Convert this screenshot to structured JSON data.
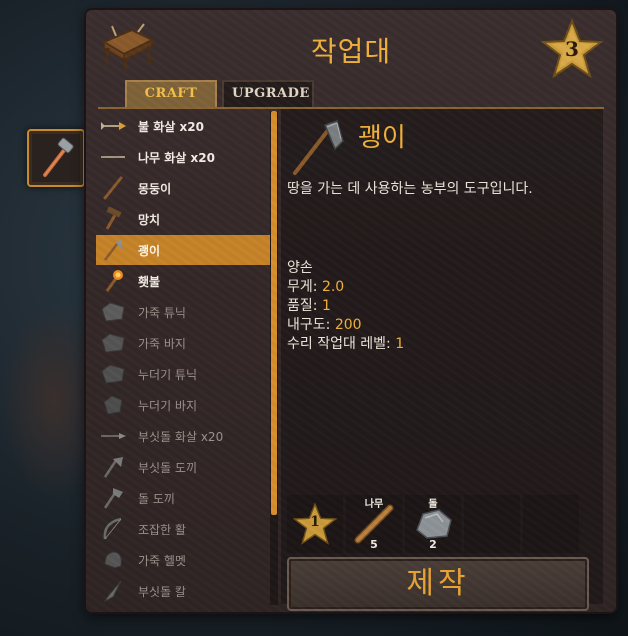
{
  "panel": {
    "title": "작업대",
    "station_level": "3",
    "tabs": [
      {
        "label": "CRAFT",
        "active": true
      },
      {
        "label": "UPGRADE",
        "active": false
      }
    ]
  },
  "recipes": [
    {
      "label": "불 화살 x20",
      "icon": "fire-arrow-icon",
      "state": "available"
    },
    {
      "label": "나무 화살 x20",
      "icon": "wood-arrow-icon",
      "state": "available"
    },
    {
      "label": "몽둥이",
      "icon": "club-icon",
      "state": "available"
    },
    {
      "label": "망치",
      "icon": "hammer-icon",
      "state": "available"
    },
    {
      "label": "괭이",
      "icon": "hoe-icon",
      "state": "selected"
    },
    {
      "label": "횃불",
      "icon": "torch-icon",
      "state": "available"
    },
    {
      "label": "가죽 튜닉",
      "icon": "leather-tunic-icon",
      "state": "locked"
    },
    {
      "label": "가죽 바지",
      "icon": "leather-pants-icon",
      "state": "locked"
    },
    {
      "label": "누더기 튜닉",
      "icon": "rag-tunic-icon",
      "state": "locked"
    },
    {
      "label": "누더기 바지",
      "icon": "rag-pants-icon",
      "state": "locked"
    },
    {
      "label": "부싯돌 화살 x20",
      "icon": "flint-arrow-icon",
      "state": "locked"
    },
    {
      "label": "부싯돌 도끼",
      "icon": "flint-axe-icon",
      "state": "locked"
    },
    {
      "label": "돌 도끼",
      "icon": "stone-axe-icon",
      "state": "locked"
    },
    {
      "label": "조잡한 활",
      "icon": "crude-bow-icon",
      "state": "locked"
    },
    {
      "label": "가죽 헬멧",
      "icon": "leather-helmet-icon",
      "state": "locked"
    },
    {
      "label": "부싯돌 칼",
      "icon": "flint-knife-icon",
      "state": "locked"
    }
  ],
  "detail": {
    "name": "괭이",
    "description": "땅을 가는 데 사용하는 농부의 도구입니다.",
    "hand": "양손",
    "stats": [
      {
        "label": "무게: ",
        "value": "2.0"
      },
      {
        "label": "품질: ",
        "value": "1"
      },
      {
        "label": "내구도: ",
        "value": "200"
      },
      {
        "label": "수리 작업대 레벨: ",
        "value": "1"
      }
    ],
    "required_station_level": "1",
    "requirements": [
      {
        "name": "나무",
        "count": "5",
        "icon": "wood-icon"
      },
      {
        "name": "돌",
        "count": "2",
        "icon": "stone-icon"
      }
    ],
    "craft_label": "제작"
  },
  "colors": {
    "accent": "#f0b03a",
    "selected_row": "#c58328",
    "scrollbar": "#d78d2c"
  }
}
